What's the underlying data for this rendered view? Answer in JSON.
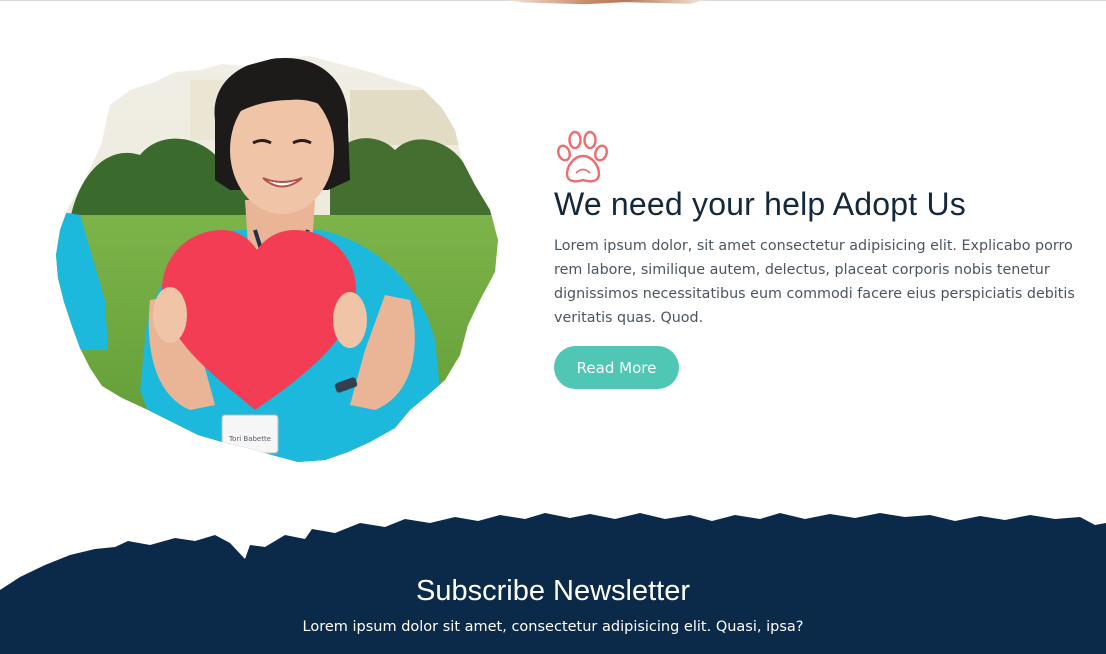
{
  "adopt_section": {
    "title": "We need your help Adopt Us",
    "text": "Lorem ipsum dolor, sit amet consectetur adipisicing elit. Explicabo porro rem labore, similique autem, delectus, placeat corporis nobis tenetur dignissimos necessitatibus eum commodi facere eius perspiciatis debitis veritatis quas. Quod.",
    "button_label": "Read More",
    "icon": "paw-icon",
    "image_badge": "Tori Babette"
  },
  "newsletter": {
    "title": "Subscribe Newsletter",
    "subtitle": "Lorem ipsum dolor sit amet, consectetur adipisicing elit. Quasi, ipsa?"
  },
  "colors": {
    "accent": "#50c7b5",
    "paw": "#ef6b6f",
    "heading": "#14283c",
    "body_text": "#4a5560",
    "newsletter_bg": "#0b2a4a",
    "heart": "#f23d55",
    "scrubs": "#1cb9dc"
  }
}
